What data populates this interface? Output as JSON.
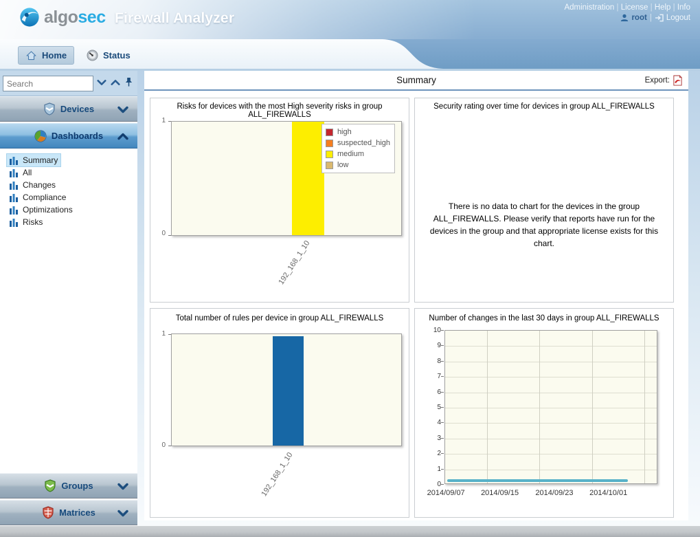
{
  "header": {
    "brand_algo": "algo",
    "brand_sec": "sec",
    "product_title": "Firewall Analyzer",
    "links": [
      "Administration",
      "License",
      "Help",
      "Info"
    ],
    "username": "root",
    "logout_label": "Logout"
  },
  "tabs": {
    "home": "Home",
    "status": "Status"
  },
  "sidebar": {
    "search_placeholder": "Search",
    "devices_label": "Devices",
    "dashboards_label": "Dashboards",
    "groups_label": "Groups",
    "matrices_label": "Matrices",
    "dashboard_items": [
      "Summary",
      "All",
      "Changes",
      "Compliance",
      "Optimizations",
      "Risks"
    ],
    "selected_item": "Summary"
  },
  "main": {
    "title": "Summary",
    "export_label": "Export:"
  },
  "chart_data": [
    {
      "type": "bar",
      "title": "Risks for devices with the most High severity risks in group ALL_FIREWALLS",
      "categories": [
        "192_168_1_10"
      ],
      "series": [
        {
          "name": "high",
          "color": "#c4262e",
          "values": [
            0
          ]
        },
        {
          "name": "suspected_high",
          "color": "#f57e20",
          "values": [
            0
          ]
        },
        {
          "name": "medium",
          "color": "#fdee00",
          "values": [
            1
          ]
        },
        {
          "name": "low",
          "color": "#dbb96f",
          "values": [
            0
          ]
        }
      ],
      "ylim": [
        0,
        1
      ],
      "yticks": [
        0,
        1
      ],
      "legend_position": "top-right",
      "plot_bg": "#fbfbef"
    },
    {
      "type": "none",
      "title": "Security rating over time for devices in group ALL_FIREWALLS",
      "no_data_message": "There is no data to chart for the devices in the group ALL_FIREWALLS. Please verify that reports have run for the devices in the group and that appropriate license exists for this chart."
    },
    {
      "type": "bar",
      "title": "Total number of rules per device in group ALL_FIREWALLS",
      "categories": [
        "192_168_1_10"
      ],
      "values": [
        1
      ],
      "bar_color": "#1767a5",
      "ylim": [
        0,
        1
      ],
      "yticks": [
        0,
        1
      ],
      "plot_bg": "#fbfbef"
    },
    {
      "type": "line",
      "title": "Number of changes in the last 30 days in group ALL_FIREWALLS",
      "x_labels": [
        "2014/09/07",
        "2014/09/15",
        "2014/09/23",
        "2014/10/01"
      ],
      "y_values_note": "flat series at 0 changes across the 30-day window",
      "y_values": [
        0,
        0,
        0,
        0
      ],
      "line_color": "#58b2c9",
      "ylim": [
        0,
        10
      ],
      "ytick_step": 1,
      "grid": true,
      "plot_bg": "#fbfbef"
    }
  ]
}
